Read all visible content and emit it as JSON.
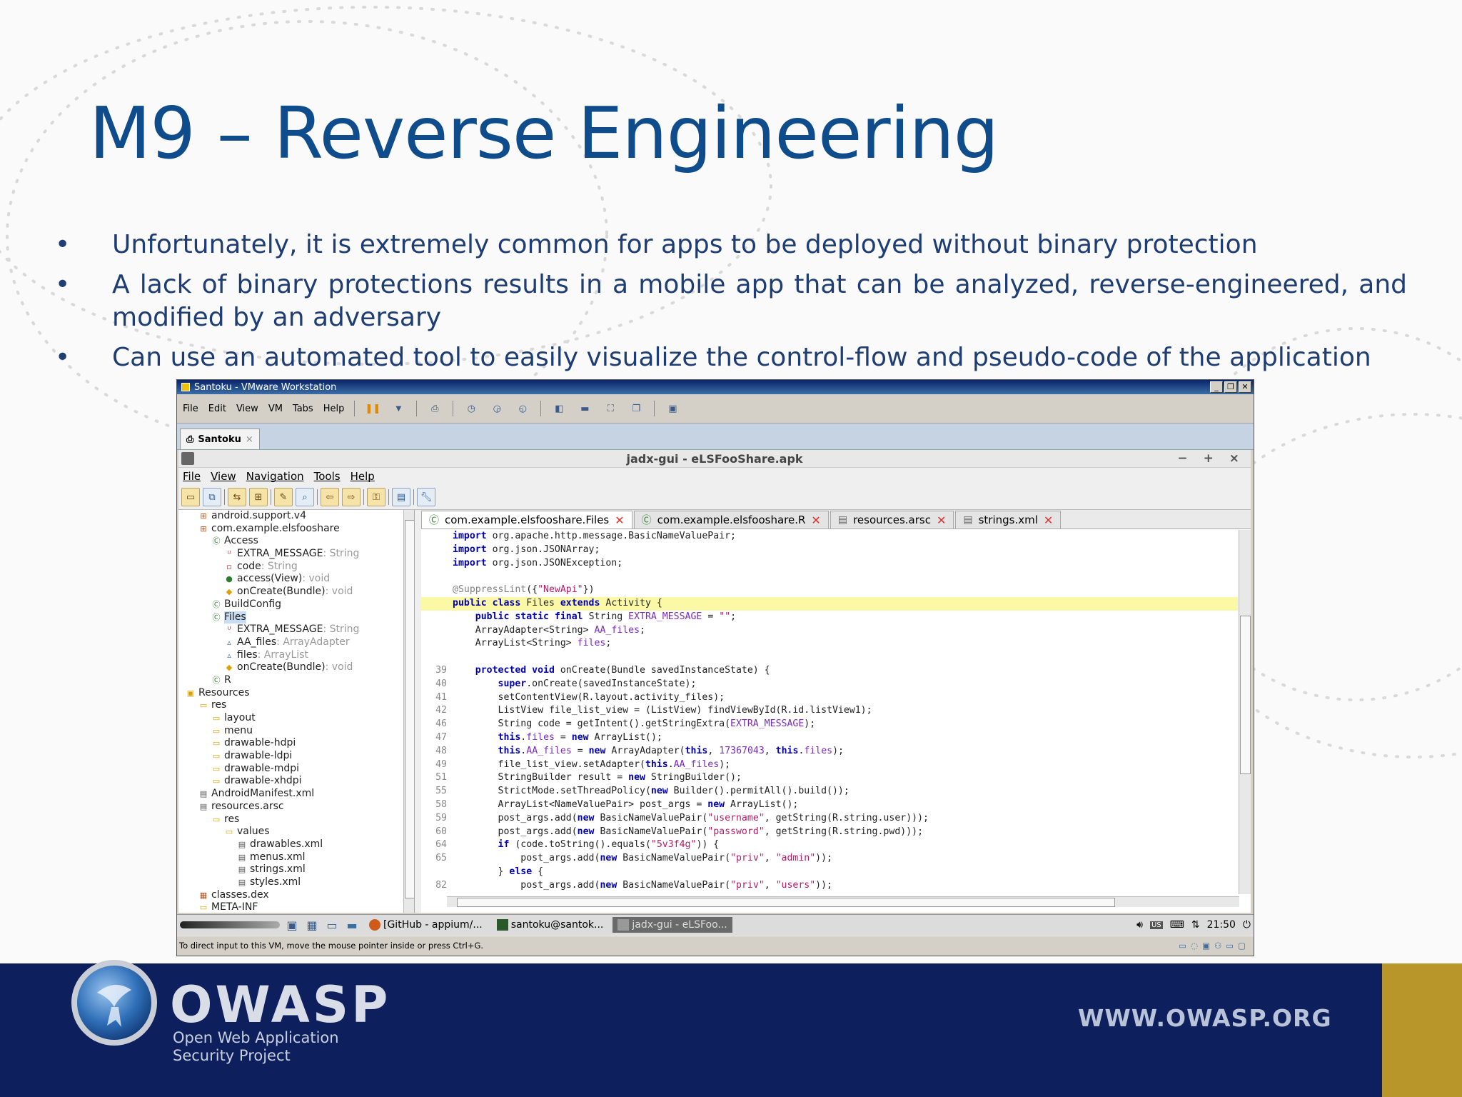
{
  "slide": {
    "title": "M9 – Reverse Engineering",
    "bullets": [
      "Unfortunately, it is extremely common for apps to be deployed without binary protection",
      "A lack of binary protections results in a mobile app that can be analyzed, reverse-engineered, and modified by an adversary",
      "Can use an automated tool to easily visualize the control-flow and pseudo-code of the application"
    ],
    "bullet_glyph": "•"
  },
  "vmware": {
    "title": "Santoku - VMware Workstation",
    "menu": [
      "File",
      "Edit",
      "View",
      "VM",
      "Tabs",
      "Help"
    ],
    "tab": "Santoku",
    "status": "To direct input to this VM, move the mouse pointer inside or press Ctrl+G."
  },
  "jadx": {
    "title": "jadx-gui - eLSFooShare.apk",
    "window_controls": "− + ×",
    "menu": [
      "File",
      "View",
      "Navigation",
      "Tools",
      "Help"
    ],
    "tree": [
      {
        "indent": 1,
        "glyph": "⊞",
        "label": "android.support.v4",
        "type": ""
      },
      {
        "indent": 1,
        "glyph": "⊞",
        "label": "com.example.elsfooshare",
        "type": ""
      },
      {
        "indent": 2,
        "glyph": "Ⓒ",
        "label": "Access",
        "type": ""
      },
      {
        "indent": 3,
        "glyph": "ᵁ",
        "label": "EXTRA_MESSAGE",
        "type": " : String"
      },
      {
        "indent": 3,
        "glyph": "▫",
        "label": "code",
        "type": " : String"
      },
      {
        "indent": 3,
        "glyph": "●",
        "label": "access(View)",
        "type": " : void"
      },
      {
        "indent": 3,
        "glyph": "◆",
        "label": "onCreate(Bundle)",
        "type": " : void"
      },
      {
        "indent": 2,
        "glyph": "Ⓒ",
        "label": "BuildConfig",
        "type": ""
      },
      {
        "indent": 2,
        "glyph": "Ⓒ",
        "label": "Files",
        "type": "",
        "selected": true
      },
      {
        "indent": 3,
        "glyph": "ᵁ",
        "label": "EXTRA_MESSAGE",
        "type": " : String"
      },
      {
        "indent": 3,
        "glyph": "▵",
        "label": "AA_files",
        "type": " : ArrayAdapter"
      },
      {
        "indent": 3,
        "glyph": "▵",
        "label": "files",
        "type": " : ArrayList"
      },
      {
        "indent": 3,
        "glyph": "◆",
        "label": "onCreate(Bundle)",
        "type": " : void"
      },
      {
        "indent": 2,
        "glyph": "Ⓒ",
        "label": "R",
        "type": ""
      },
      {
        "indent": 0,
        "glyph": "▣",
        "label": "Resources",
        "type": ""
      },
      {
        "indent": 1,
        "glyph": "▭",
        "label": "res",
        "type": ""
      },
      {
        "indent": 2,
        "glyph": "▭",
        "label": "layout",
        "type": ""
      },
      {
        "indent": 2,
        "glyph": "▭",
        "label": "menu",
        "type": ""
      },
      {
        "indent": 2,
        "glyph": "▭",
        "label": "drawable-hdpi",
        "type": ""
      },
      {
        "indent": 2,
        "glyph": "▭",
        "label": "drawable-ldpi",
        "type": ""
      },
      {
        "indent": 2,
        "glyph": "▭",
        "label": "drawable-mdpi",
        "type": ""
      },
      {
        "indent": 2,
        "glyph": "▭",
        "label": "drawable-xhdpi",
        "type": ""
      },
      {
        "indent": 1,
        "glyph": "▤",
        "label": "AndroidManifest.xml",
        "type": ""
      },
      {
        "indent": 1,
        "glyph": "▤",
        "label": "resources.arsc",
        "type": ""
      },
      {
        "indent": 2,
        "glyph": "▭",
        "label": "res",
        "type": ""
      },
      {
        "indent": 3,
        "glyph": "▭",
        "label": "values",
        "type": ""
      },
      {
        "indent": 4,
        "glyph": "▤",
        "label": "drawables.xml",
        "type": ""
      },
      {
        "indent": 4,
        "glyph": "▤",
        "label": "menus.xml",
        "type": ""
      },
      {
        "indent": 4,
        "glyph": "▤",
        "label": "strings.xml",
        "type": ""
      },
      {
        "indent": 4,
        "glyph": "▤",
        "label": "styles.xml",
        "type": ""
      },
      {
        "indent": 1,
        "glyph": "▦",
        "label": "classes.dex",
        "type": ""
      },
      {
        "indent": 1,
        "glyph": "▭",
        "label": "META-INF",
        "type": ""
      }
    ],
    "tabs": [
      {
        "label": "com.example.elsfooshare.Files",
        "active": true,
        "glyph": "Ⓒ"
      },
      {
        "label": "com.example.elsfooshare.R",
        "active": false,
        "glyph": "Ⓒ"
      },
      {
        "label": "resources.arsc",
        "active": false,
        "glyph": "▤"
      },
      {
        "label": "strings.xml",
        "active": false,
        "glyph": "▤"
      }
    ],
    "code": [
      {
        "ln": "",
        "html": "<span class='kw'>import</span> org.apache.http.message.BasicNameValuePair;"
      },
      {
        "ln": "",
        "html": "<span class='kw'>import</span> org.json.JSONArray;"
      },
      {
        "ln": "",
        "html": "<span class='kw'>import</span> org.json.JSONException;"
      },
      {
        "ln": "",
        "html": ""
      },
      {
        "ln": "",
        "html": "<span class='an'>@SuppressLint</span>({<span class='st'>\"NewApi\"</span>})"
      },
      {
        "ln": "",
        "html": "<span class='kw'>public class</span> Files <span class='kw'>extends</span> Activity {",
        "hl": true
      },
      {
        "ln": "",
        "html": "    <span class='kw'>public static final</span> String <span class='fd'>EXTRA_MESSAGE</span> = <span class='st'>\"\"</span>;"
      },
      {
        "ln": "",
        "html": "    ArrayAdapter&lt;String&gt; <span class='fd'>AA_files</span>;"
      },
      {
        "ln": "",
        "html": "    ArrayList&lt;String&gt; <span class='fd'>files</span>;"
      },
      {
        "ln": "",
        "html": ""
      },
      {
        "ln": "39",
        "html": "    <span class='kw'>protected void</span> onCreate(Bundle savedInstanceState) {"
      },
      {
        "ln": "40",
        "html": "        <span class='kw'>super</span>.onCreate(savedInstanceState);"
      },
      {
        "ln": "41",
        "html": "        setContentView(R.layout.activity_files);"
      },
      {
        "ln": "42",
        "html": "        ListView file_list_view = (ListView) findViewById(R.id.listView1);"
      },
      {
        "ln": "46",
        "html": "        String code = getIntent().getStringExtra(<span class='fd'>EXTRA_MESSAGE</span>);"
      },
      {
        "ln": "47",
        "html": "        <span class='kw'>this</span>.<span class='fd'>files</span> = <span class='kw'>new</span> ArrayList();"
      },
      {
        "ln": "48",
        "html": "        <span class='kw'>this</span>.<span class='fd'>AA_files</span> = <span class='kw'>new</span> ArrayAdapter(<span class='kw'>this</span>, <span class='fd'>17367043</span>, <span class='kw'>this</span>.<span class='fd'>files</span>);"
      },
      {
        "ln": "49",
        "html": "        file_list_view.setAdapter(<span class='kw'>this</span>.<span class='fd'>AA_files</span>);"
      },
      {
        "ln": "51",
        "html": "        StringBuilder result = <span class='kw'>new</span> StringBuilder();"
      },
      {
        "ln": "55",
        "html": "        StrictMode.setThreadPolicy(<span class='kw'>new</span> Builder().permitAll().build());"
      },
      {
        "ln": "58",
        "html": "        ArrayList&lt;NameValuePair&gt; post_args = <span class='kw'>new</span> ArrayList();"
      },
      {
        "ln": "59",
        "html": "        post_args.add(<span class='kw'>new</span> BasicNameValuePair(<span class='st'>\"username\"</span>, getString(R.string.user)));"
      },
      {
        "ln": "60",
        "html": "        post_args.add(<span class='kw'>new</span> BasicNameValuePair(<span class='st'>\"password\"</span>, getString(R.string.pwd)));"
      },
      {
        "ln": "64",
        "html": "        <span class='kw'>if</span> (code.toString().equals(<span class='st'>\"5v3f4g\"</span>)) {"
      },
      {
        "ln": "65",
        "html": "            post_args.add(<span class='kw'>new</span> BasicNameValuePair(<span class='st'>\"priv\"</span>, <span class='st'>\"admin\"</span>));"
      },
      {
        "ln": "",
        "html": "        } <span class='kw'>else</span> {"
      },
      {
        "ln": "82",
        "html": "            post_args.add(<span class='kw'>new</span> BasicNameValuePair(<span class='st'>\"priv\"</span>, <span class='st'>\"users\"</span>));"
      },
      {
        "ln": "",
        "html": "        }"
      }
    ]
  },
  "taskbar": {
    "tasks": [
      "[GitHub - appium/...",
      "santoku@santok...",
      "jadx-gui - eLSFoo..."
    ],
    "clock": "21:50",
    "lang": "US"
  },
  "footer": {
    "org": "OWASP",
    "sub1": "Open Web Application",
    "sub2": "Security Project",
    "url": "WWW.OWASP.ORG"
  },
  "colors": {
    "title": "#0e4c8c",
    "bullets": "#1f3d75",
    "footer_bg": "#0d1f5c",
    "footer_gold": "#b8962a"
  }
}
